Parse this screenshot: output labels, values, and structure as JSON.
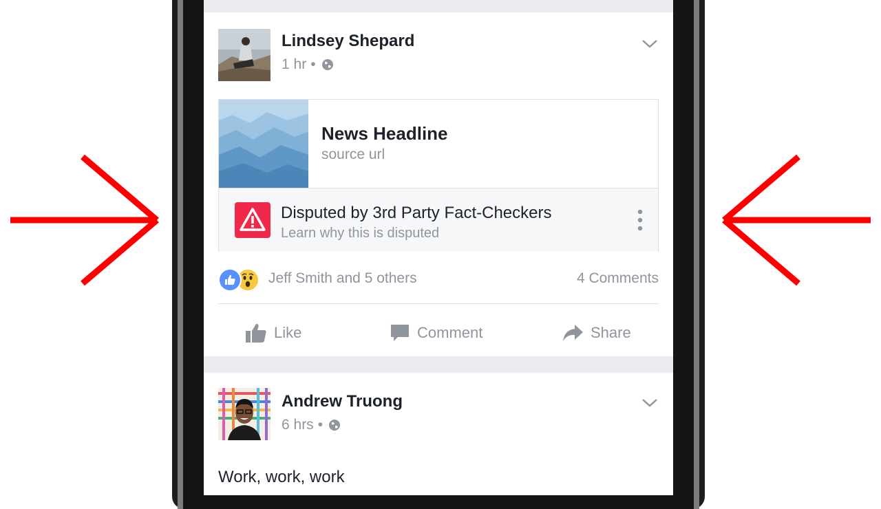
{
  "colors": {
    "arrow": "#ff0000",
    "name_text": "#1d2129",
    "meta_text": "#90949c",
    "warning": "#f02849",
    "like_reaction": "#5890ff",
    "wow_reaction": "#f7c93c",
    "feed_bg": "#e9ebee"
  },
  "post1": {
    "author": "Lindsey Shepard",
    "time": "1 hr",
    "separator": "•",
    "privacy_icon": "globe-icon",
    "menu_icon": "chevron-down-icon",
    "link": {
      "title": "News Headline",
      "url": "source url",
      "dispute_title": "Disputed by 3rd Party Fact-Checkers",
      "dispute_subtitle": "Learn why this is disputed",
      "warning_icon": "warning-icon",
      "more_icon": "more-vertical-icon"
    },
    "reactions": {
      "icons": [
        "like-reaction-icon",
        "wow-reaction-icon"
      ],
      "text": "Jeff Smith and 5 others",
      "comments": "4 Comments"
    },
    "actions": [
      {
        "label": "Like",
        "icon": "thumbs-up-icon"
      },
      {
        "label": "Comment",
        "icon": "comment-icon"
      },
      {
        "label": "Share",
        "icon": "share-icon"
      }
    ]
  },
  "post2": {
    "author": "Andrew Truong",
    "time": "6 hrs",
    "separator": "•",
    "privacy_icon": "globe-icon",
    "menu_icon": "chevron-down-icon",
    "text": "Work, work, work"
  }
}
